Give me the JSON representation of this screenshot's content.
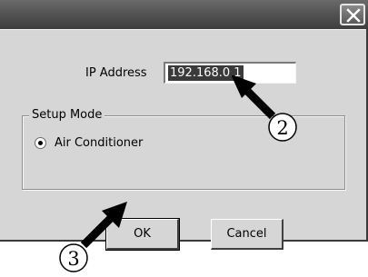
{
  "dialog": {
    "close_icon": "close-icon"
  },
  "ip": {
    "label": "IP Address",
    "value": "192.168.0.1"
  },
  "setup_mode": {
    "legend": "Setup Mode",
    "option_label": "Air Conditioner",
    "selected": true
  },
  "buttons": {
    "ok": "OK",
    "cancel": "Cancel"
  },
  "callouts": {
    "ip_step": "2",
    "ok_step": "3"
  },
  "colors": {
    "title_bar": "#545454",
    "dialog_face": "#d6d6d6",
    "selection": "#3a3a3a"
  }
}
